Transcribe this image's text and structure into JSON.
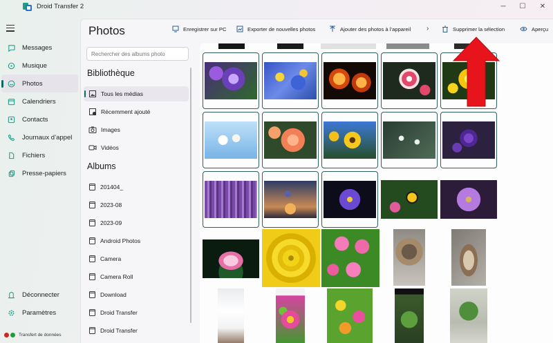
{
  "window": {
    "title": "Droid Transfer 2",
    "minimize_icon": "minimize-icon",
    "maximize_icon": "maximize-icon",
    "close_icon": "close-icon"
  },
  "nav": {
    "items": [
      {
        "label": "Messages",
        "icon": "message-icon"
      },
      {
        "label": "Musique",
        "icon": "music-icon"
      },
      {
        "label": "Photos",
        "icon": "photo-icon",
        "active": true
      },
      {
        "label": "Calendriers",
        "icon": "calendar-icon"
      },
      {
        "label": "Contacts",
        "icon": "contact-icon"
      },
      {
        "label": "Journaux d’appel",
        "icon": "phone-icon"
      },
      {
        "label": "Fichiers",
        "icon": "file-icon"
      },
      {
        "label": "Presse-papiers",
        "icon": "clipboard-icon"
      }
    ],
    "disconnect_label": "Déconnecter",
    "settings_label": "Paramètres",
    "status_label": "Transfert de données"
  },
  "page": {
    "title": "Photos"
  },
  "toolbar": {
    "save_pc_label": "Enregistrer sur PC",
    "export_new_label": "Exporter de nouvelles photos",
    "add_to_device_label": "Ajouter des photos à l’appareil",
    "delete_selection_label": "Supprimer la sélection",
    "preview_label": "Aperçu"
  },
  "sidebar": {
    "search_placeholder": "Rechercher des albums photo",
    "library_title": "Bibliothèque",
    "library_items": [
      {
        "label": "Tous les médias",
        "active": true
      },
      {
        "label": "Récemment ajouté"
      },
      {
        "label": "Images"
      },
      {
        "label": "Vidéos"
      }
    ],
    "albums_title": "Albums",
    "albums": [
      "201404_",
      "2023-08",
      "2023-09",
      "Android Photos",
      "Camera",
      "Camera Roll",
      "Download",
      "Droid Transfer",
      "Droid Transfer"
    ]
  },
  "colors": {
    "accent": "#0b6b63",
    "selection_border": "#2c5e62",
    "annotation_arrow": "#e8141b",
    "status_red": "#c8281f",
    "status_green": "#1f9d3a"
  },
  "photos": [
    {
      "subject": "purple allium flowers",
      "selected": true
    },
    {
      "subject": "blue and yellow wildflowers",
      "selected": true
    },
    {
      "subject": "orange flowers on dark background",
      "selected": true
    },
    {
      "subject": "pink striped lilies",
      "selected": true
    },
    {
      "subject": "yellow lilies",
      "selected": true
    },
    {
      "subject": "white blossoms against blue sky",
      "selected": true
    },
    {
      "subject": "orange roses",
      "selected": true
    },
    {
      "subject": "sunflowers",
      "selected": true
    },
    {
      "subject": "snowdrops",
      "selected": true
    },
    {
      "subject": "purple irises",
      "selected": true
    },
    {
      "subject": "lavender field",
      "selected": true
    },
    {
      "subject": "purple flowers at sunset",
      "selected": true
    },
    {
      "subject": "purple daisy",
      "selected": true
    },
    {
      "subject": "swallowtail butterfly on flowers",
      "selected": false
    },
    {
      "subject": "purple daisy close-up",
      "selected": false
    },
    {
      "subject": "pink lotus",
      "selected": false
    },
    {
      "subject": "yellow rose",
      "selected": false
    },
    {
      "subject": "pink cosmos flowers",
      "selected": false
    },
    {
      "subject": "tabby cat",
      "selected": false
    },
    {
      "subject": "cat lying on wood",
      "selected": false
    },
    {
      "subject": "bright window photo",
      "selected": false
    },
    {
      "subject": "flower screenshot",
      "selected": false
    },
    {
      "subject": "colorful daisies",
      "selected": false
    },
    {
      "subject": "plant screenshot",
      "selected": false
    },
    {
      "subject": "green plant",
      "selected": false
    }
  ]
}
